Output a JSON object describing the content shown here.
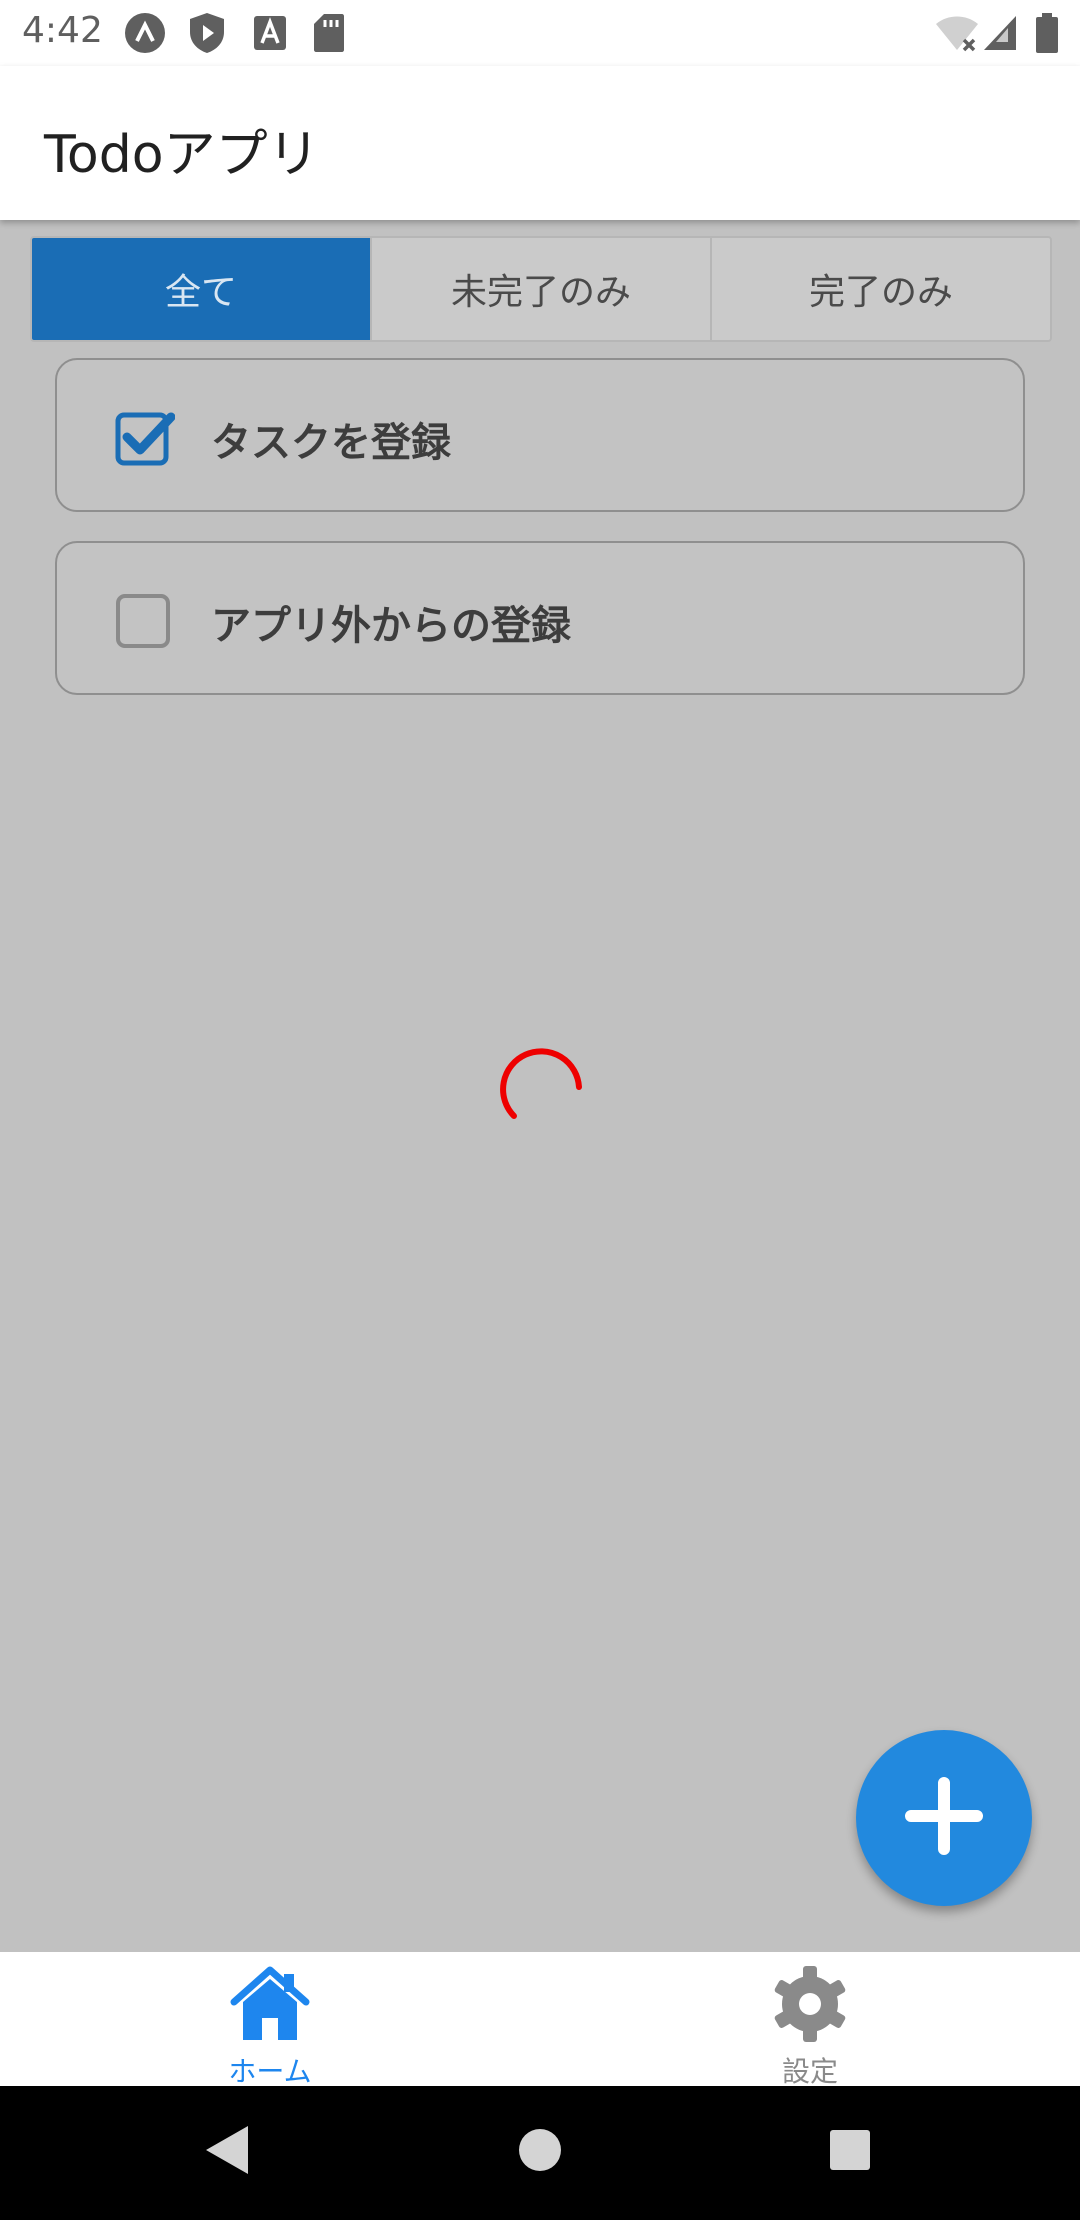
{
  "status_bar": {
    "time": "4:42",
    "icons_left": [
      "nav-a-icon",
      "shield-play-icon",
      "font-a-icon",
      "sd-card-icon"
    ],
    "icons_right": [
      "wifi-off-icon",
      "cell-signal-icon",
      "battery-icon"
    ]
  },
  "app_bar": {
    "title": "Todoアプリ"
  },
  "tabs": [
    {
      "label": "全て",
      "active": true
    },
    {
      "label": "未完了のみ",
      "active": false
    },
    {
      "label": "完了のみ",
      "active": false
    }
  ],
  "tasks": [
    {
      "label": "タスクを登録",
      "checked": true
    },
    {
      "label": "アプリ外からの登録",
      "checked": false
    }
  ],
  "loading": {
    "spinner_color": "#ee0000"
  },
  "fab": {
    "icon": "plus-icon",
    "color": "#2289de"
  },
  "bottom_nav": {
    "items": [
      {
        "label": "ホーム",
        "icon": "home-icon",
        "active": true
      },
      {
        "label": "設定",
        "icon": "gear-icon",
        "active": false
      }
    ]
  },
  "system_nav": {
    "icons": [
      "back-icon",
      "home-circle-icon",
      "recents-icon"
    ]
  },
  "colors": {
    "accent": "#1a6db5",
    "active_nav": "#1e86ee",
    "scrim_background": "#c1c1c1"
  }
}
